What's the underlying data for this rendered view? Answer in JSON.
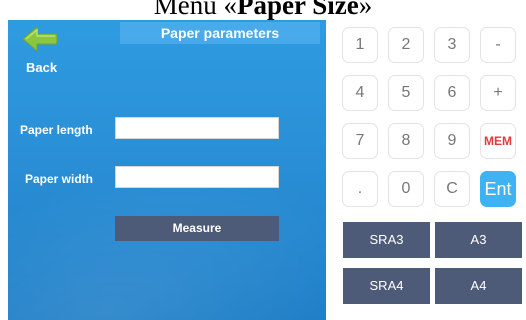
{
  "document_heading": {
    "prefix": "Menu «",
    "bold": "Paper Size",
    "suffix": "»"
  },
  "header": {
    "back_label": "Back",
    "title": "Paper parameters"
  },
  "form": {
    "length_label": "Paper length",
    "length_value": "",
    "width_label": "Paper width",
    "width_value": "",
    "measure_label": "Measure"
  },
  "keypad": {
    "keys": [
      "1",
      "2",
      "3",
      "-",
      "4",
      "5",
      "6",
      "+",
      "7",
      "8",
      "9",
      "MEM",
      ".",
      "0",
      "C",
      "Ent"
    ]
  },
  "paper_sizes": [
    "SRA3",
    "A3",
    "SRA4",
    "A4"
  ],
  "colors": {
    "panel_blue": "#2a8fd6",
    "button_slate": "#4d5a78",
    "enter_blue": "#3fb3f2",
    "mem_red": "#e23b3b",
    "back_arrow_green": "#8cc63f"
  },
  "icons": {
    "back": "left-arrow-icon"
  }
}
